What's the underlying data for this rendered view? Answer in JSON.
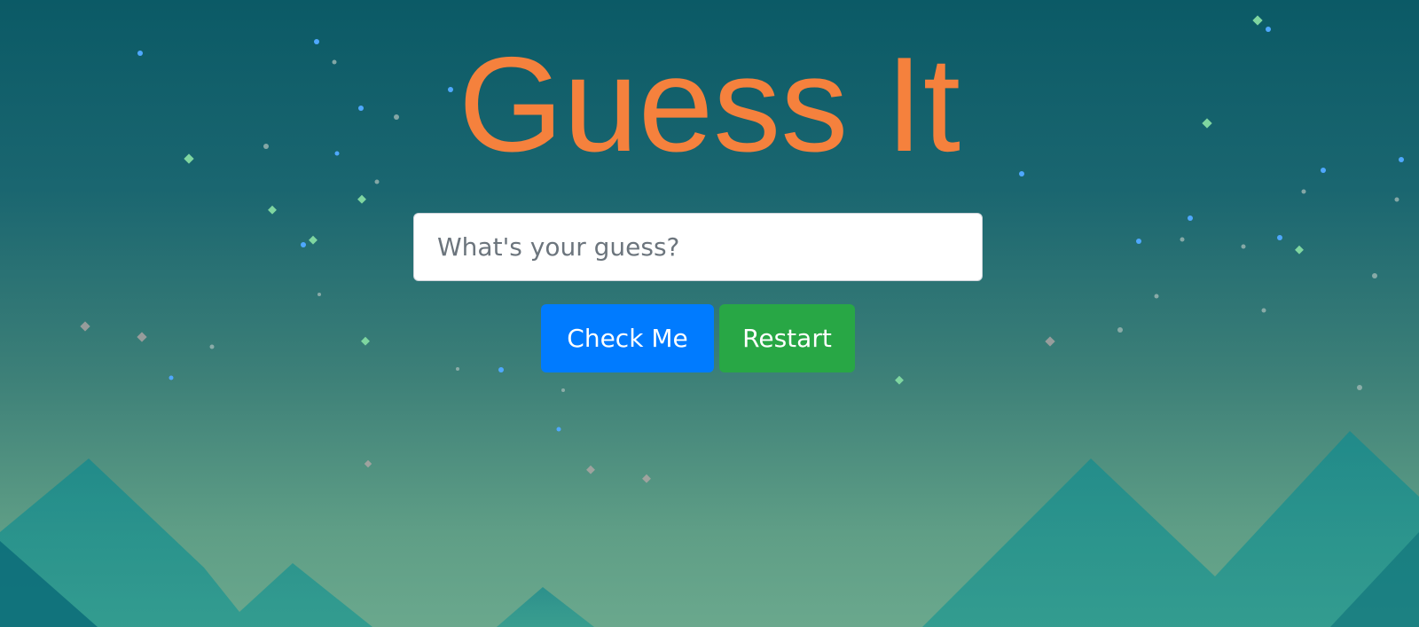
{
  "page": {
    "title": "Guess It"
  },
  "input": {
    "placeholder": "What's your guess?",
    "value": ""
  },
  "buttons": {
    "check_label": "Check Me",
    "restart_label": "Restart"
  },
  "colors": {
    "title": "#f5813d",
    "check_button": "#007bff",
    "restart_button": "#28a745",
    "background_top": "#0b5a66",
    "background_bottom": "#6aa88d",
    "mountain": "#1d8b8b"
  }
}
